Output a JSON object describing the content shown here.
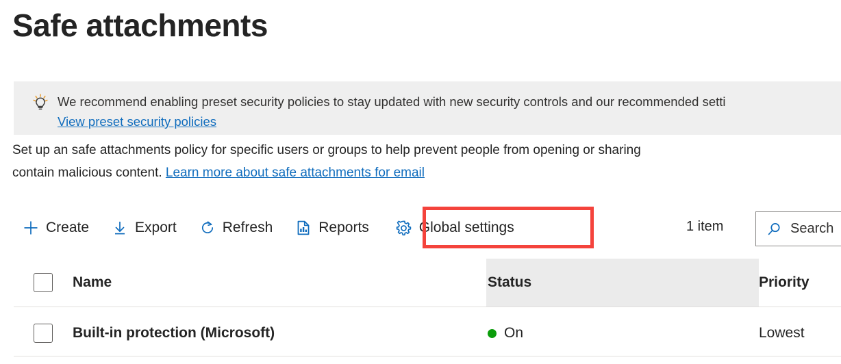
{
  "page": {
    "title": "Safe attachments"
  },
  "banner": {
    "icon": "lightbulb-icon",
    "message": "We recommend enabling preset security policies to stay updated with new security controls and our recommended setti",
    "link_label": "View preset security policies",
    "background_color": "#efefef"
  },
  "description": {
    "text_before": "Set up an safe attachments policy for specific users or groups to help prevent people from opening or sharing",
    "text_middle": "contain malicious content. ",
    "link_label": "Learn more about safe attachments for email",
    "link_color": "#0f6cbd"
  },
  "command_bar": {
    "buttons": [
      {
        "label": "Create",
        "icon": "plus-icon"
      },
      {
        "label": "Export",
        "icon": "download-arrow-icon"
      },
      {
        "label": "Refresh",
        "icon": "refresh-icon"
      },
      {
        "label": "Reports",
        "icon": "report-chart-icon"
      },
      {
        "label": "Global settings",
        "icon": "gear-icon"
      }
    ],
    "item_count": "1 item",
    "search_placeholder": "Search",
    "search_value": "",
    "highlight_color": "#f4433c",
    "icon_color": "#0f6cbd"
  },
  "table": {
    "columns": [
      "Name",
      "Status",
      "Priority"
    ],
    "rows": [
      {
        "name": "Built-in protection (Microsoft)",
        "status": "On",
        "status_dot_color": "#0b9d0b",
        "priority": "Lowest",
        "selected": false
      }
    ],
    "header_hover_column": "Status"
  }
}
